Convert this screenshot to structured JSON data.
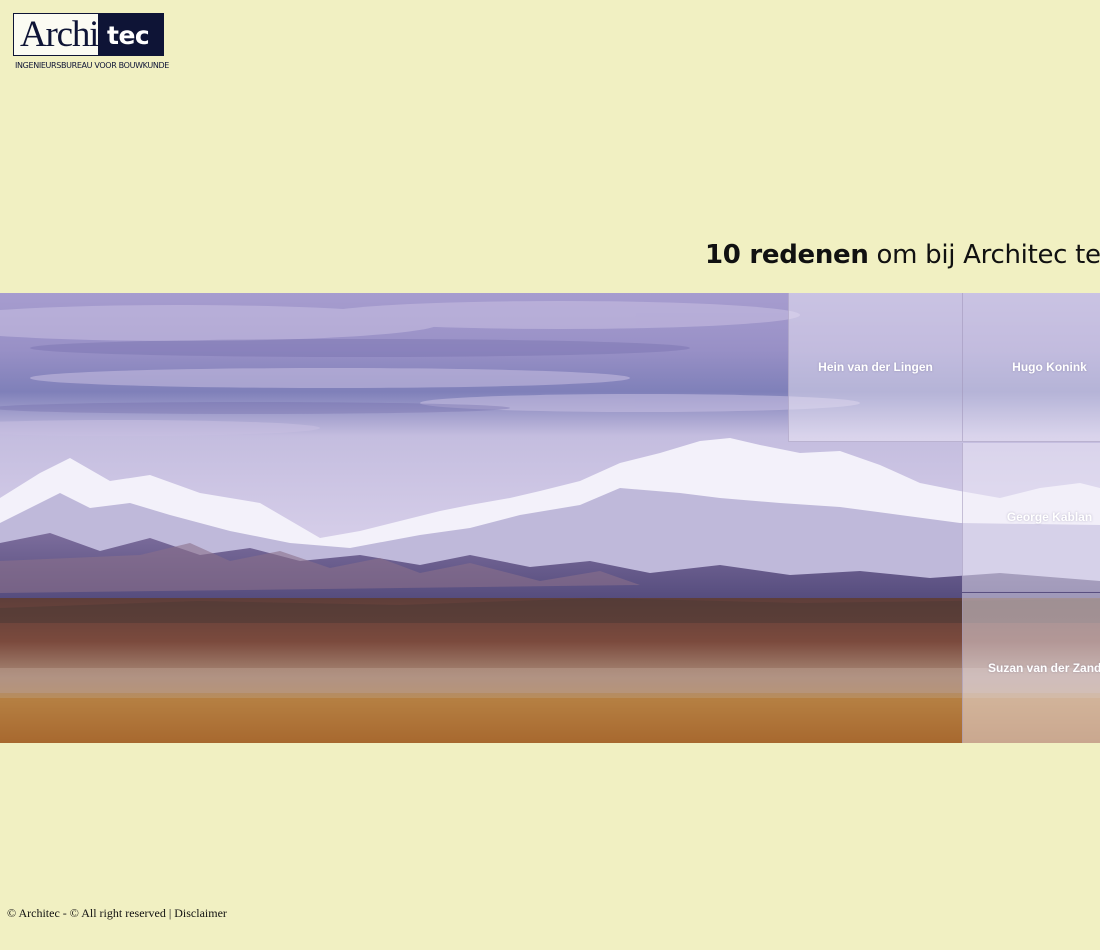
{
  "logo": {
    "part_light": "Archi",
    "part_dark": "tec",
    "tagline": "INGENIEURSBUREAU VOOR BOUWKUNDE"
  },
  "heading": {
    "bold": "10 redenen",
    "rest": " om bij Architec te we"
  },
  "team": [
    {
      "name": "Hein van der Lingen"
    },
    {
      "name": "Hugo Konink"
    },
    {
      "name": "George Kablan"
    },
    {
      "name": "Suzan van der Zande"
    }
  ],
  "footer": {
    "copyright": "© Architec - © All right reserved",
    "separator": "|",
    "disclaimer": "Disclaimer"
  },
  "colors": {
    "background": "#f1f0c2",
    "logo_navy": "#0e1436",
    "tile_overlay": "rgba(240,236,248,0.48)"
  }
}
